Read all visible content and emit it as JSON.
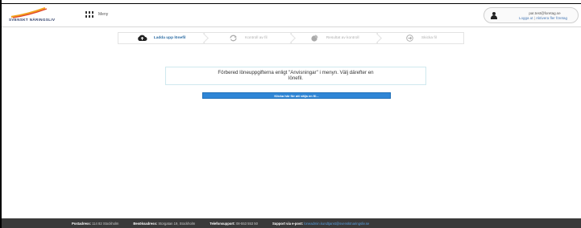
{
  "header": {
    "logo_text": "SVENSKT NÄRINGSLIV",
    "menu_label": "Meny",
    "user": {
      "email": "par.test@foretag.se",
      "logout_label": "Logga ut",
      "separator": "|",
      "switch_company_label": "Aktivera fler företag"
    }
  },
  "steps": [
    {
      "label": "Ladda upp lönefil",
      "icon": "cloud-upload-icon",
      "active": true
    },
    {
      "label": "Kontroll av fil",
      "icon": "refresh-icon",
      "active": false
    },
    {
      "label": "Resultat av kontroll",
      "icon": "pie-chart-icon",
      "active": false
    },
    {
      "label": "Skicka fil",
      "icon": "send-icon",
      "active": false
    }
  ],
  "main": {
    "notice_line1": "Förbered löneuppgifterna enligt \"Anvisningar\" i menyn. Välj därefter en",
    "notice_line2": "lönefil.",
    "choose_file_label": "Klicka här för att välja en fil..."
  },
  "footer": {
    "postal_label": "Postadress:",
    "postal_value": "114 82 Stockholm",
    "visit_label": "Besöksadress:",
    "visit_value": "Storgatan 19, Stockholm",
    "phone_label": "Telefonsupport:",
    "phone_value": "08-553 553 50",
    "support_label": "Support via e-post:",
    "support_value": "loneadmin.kundtjanst@svensktnaringsliv.se"
  },
  "colors": {
    "accent": "#2f86d6",
    "active_step": "#2e6da4",
    "footer_bg": "#3a3a3a",
    "logo_orange": "#f2a21e",
    "logo_red": "#e0452a"
  }
}
